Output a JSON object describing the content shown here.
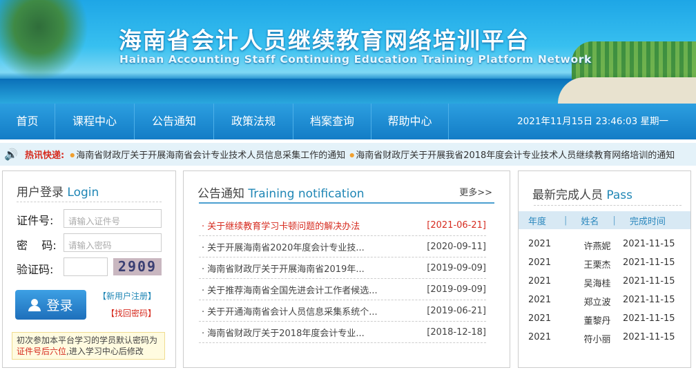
{
  "banner": {
    "title": "海南省会计人员继续教育网络培训平台",
    "subtitle": "Hainan Accounting Staff Continuing Education Training Platform Network"
  },
  "nav": {
    "items": [
      "首页",
      "课程中心",
      "公告通知",
      "政策法规",
      "档案查询",
      "帮助中心"
    ],
    "datetime": "2021年11月15日 23:46:03 星期一"
  },
  "ticker": {
    "label": "热讯快递:",
    "items": [
      "海南省财政厅关于开展海南省会计专业技术人员信息采集工作的通知",
      "海南省财政厅关于开展我省2018年度会计专业技术人员继续教育网络培训的通知"
    ]
  },
  "login": {
    "title_cn": "用户登录",
    "title_en": "Login",
    "id_label": "证件号:",
    "id_placeholder": "请输入证件号",
    "pwd_label": "密    码:",
    "pwd_placeholder": "请输入密码",
    "captcha_label": "验证码:",
    "captcha_value": "",
    "captcha_image": "2909",
    "login_button": "登录",
    "register_link": "【新用户注册】",
    "recover_link": "【找回密码】",
    "tip_prefix": "初次参加本平台学习的学员默认密码为",
    "tip_highlight": "证件号后六位",
    "tip_suffix": ",进入学习中心后修改"
  },
  "notice": {
    "title_cn": "公告通知",
    "title_en": "Training notification",
    "more": "更多>>",
    "items": [
      {
        "title": "关于继续教育学习卡顿问题的解决办法",
        "date": "[2021-06-21]"
      },
      {
        "title": "关于开展海南省2020年度会计专业技...",
        "date": "[2020-09-11]"
      },
      {
        "title": "海南省财政厅关于开展海南省2019年...",
        "date": "[2019-09-09]"
      },
      {
        "title": "关于推荐海南省全国先进会计工作者候选...",
        "date": "[2019-09-09]"
      },
      {
        "title": "关于开通海南省会计人员信息采集系统个...",
        "date": "[2019-06-21]"
      },
      {
        "title": "海南省财政厅关于2018年度会计专业...",
        "date": "[2018-12-18]"
      }
    ]
  },
  "pass": {
    "title_cn": "最新完成人员",
    "title_en": "Pass",
    "headers": [
      "年度",
      "姓名",
      "完成时间"
    ],
    "rows": [
      [
        "2021",
        "许燕妮",
        "2021-11-15"
      ],
      [
        "2021",
        "王栗杰",
        "2021-11-15"
      ],
      [
        "2021",
        "吴海桂",
        "2021-11-15"
      ],
      [
        "2021",
        "郑立波",
        "2021-11-15"
      ],
      [
        "2021",
        "董黎丹",
        "2021-11-15"
      ],
      [
        "2021",
        "符小丽",
        "2021-11-15"
      ]
    ]
  },
  "colors": {
    "nav": "#1a8ad4",
    "accent": "#1f86b5",
    "highlight": "#d62b1f"
  }
}
